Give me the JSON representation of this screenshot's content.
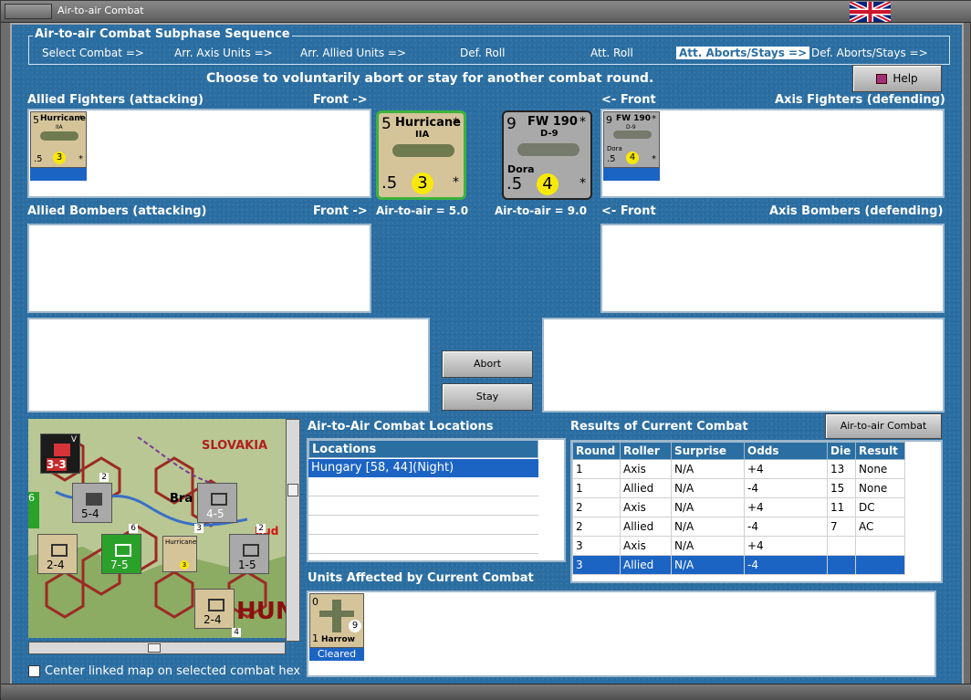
{
  "window": {
    "title": "Air-to-air Combat"
  },
  "sequence": {
    "title": "Air-to-air Combat Subphase Sequence",
    "steps": [
      "Select Combat =>",
      "Arr. Axis Units =>",
      "Arr. Allied Units =>",
      "Def. Roll",
      "Att. Roll",
      "Att. Aborts/Stays =>",
      "Def. Aborts/Stays =>"
    ],
    "active_index": 5
  },
  "instruction": "Choose to voluntarily abort or stay for another combat round.",
  "help_label": "Help",
  "allied_fighters_label": "Allied Fighters (attacking)",
  "front_right": "Front ->",
  "front_left": "<- Front",
  "axis_fighters_label": "Axis Fighters (defending)",
  "allied_bombers_label": "Allied Bombers (attacking)",
  "axis_bombers_label": "Axis Bombers (defending)",
  "allied_unit": {
    "name": "Hurricane",
    "variant": "IIA",
    "top_value": "5",
    "bottom_value": ".5",
    "circle_value": "3",
    "star": "*",
    "a2a_text": "Air-to-air = 5.0"
  },
  "axis_unit": {
    "name": "FW 190",
    "variant": "D-9",
    "pilot": "Dora",
    "top_value": "9",
    "bottom_value": ".5",
    "circle_value": "4",
    "star": "*",
    "a2a_text": "Air-to-air = 9.0"
  },
  "abort_label": "Abort",
  "stay_label": "Stay",
  "locations": {
    "title": "Air-to-Air Combat Locations",
    "header": "Locations",
    "rows": [
      "Hungary [58, 44](Night)"
    ]
  },
  "results": {
    "title": "Results of Current Combat",
    "chart_button": "Air-to-air Combat Chart",
    "headers": [
      "Round",
      "Roller",
      "Surprise",
      "Odds",
      "Die",
      "Result"
    ],
    "rows": [
      [
        "1",
        "Axis",
        "N/A",
        "+4",
        "13",
        "None"
      ],
      [
        "1",
        "Allied",
        "N/A",
        "-4",
        "15",
        "None"
      ],
      [
        "2",
        "Axis",
        "N/A",
        "+4",
        "11",
        "DC"
      ],
      [
        "2",
        "Allied",
        "N/A",
        "-4",
        "7",
        "AC"
      ],
      [
        "3",
        "Axis",
        "N/A",
        "+4",
        "",
        ""
      ],
      [
        "3",
        "Allied",
        "N/A",
        "-4",
        "",
        ""
      ]
    ],
    "selected_row": 5
  },
  "affected": {
    "title": "Units Affected by Current Combat",
    "unit_name": "Harrow",
    "top_value": "0",
    "bottom_value": "1",
    "circle_value": "9",
    "status": "Cleared"
  },
  "center_map_label": "Center linked map on selected combat hex",
  "map": {
    "labels": [
      "SLOVAKIA",
      "Bra",
      "Bud",
      "HUN"
    ],
    "counters": [
      "3-3",
      "5-4",
      "4-5",
      "2-4",
      "7-5",
      "1-5",
      "2-4",
      "6",
      "V",
      "2",
      "6",
      "3",
      "2",
      "4"
    ]
  },
  "colors": {
    "accent": "#2b6ea2",
    "selected": "#1c64c4",
    "counter_tan": "#d5c49a",
    "axis_gray": "#a9a9a9",
    "green_border": "#3db23d"
  }
}
